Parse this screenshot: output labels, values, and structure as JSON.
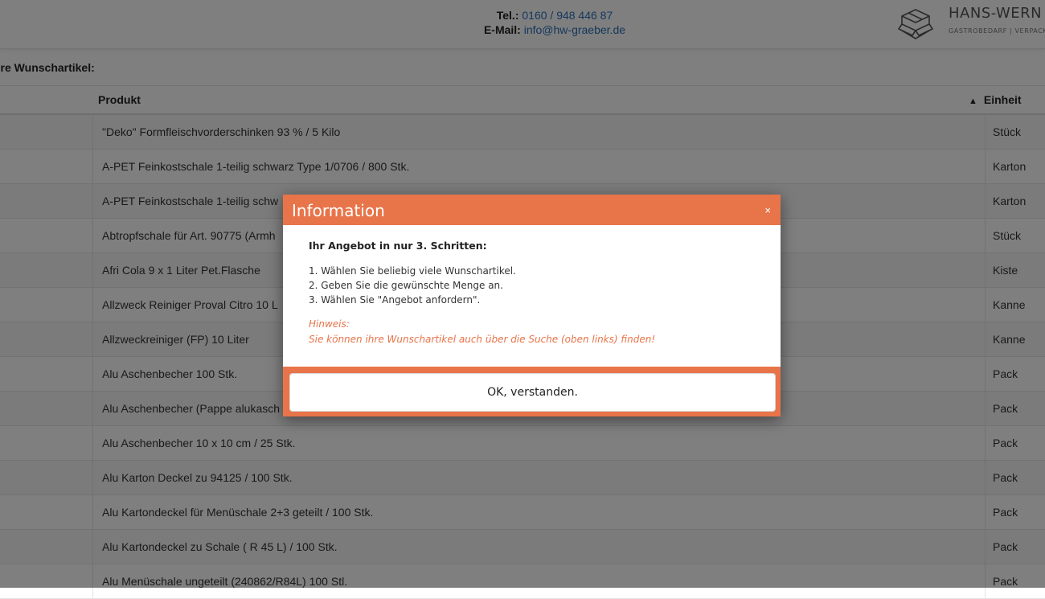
{
  "header": {
    "tel_label": "Tel.:",
    "tel_value": "0160 / 948 446 87",
    "email_label": "E-Mail:",
    "email_value": "info@hw-graeber.de",
    "logo_name": "HANS-WERN",
    "logo_tagline": "GASTROBEDARF | VERPACK",
    "logo_icon": "box-stack-icon"
  },
  "section_title": "hre Wunschartikel:",
  "table": {
    "col_product": "Produkt",
    "col_unit": "Einheit",
    "sort_icon": "caret-up-icon",
    "rows": [
      {
        "product": "\"Deko\" Formfleischvorderschinken 93 % / 5 Kilo",
        "unit": "Stück"
      },
      {
        "product": "A-PET Feinkostschale 1-teilig schwarz Type 1/0706 / 800 Stk.",
        "unit": "Karton"
      },
      {
        "product": "A-PET Feinkostschale 1-teilig schw",
        "unit": "Karton"
      },
      {
        "product": "Abtropfschale für Art. 90775 (Armh",
        "unit": "Stück"
      },
      {
        "product": "Afri Cola 9 x 1 Liter Pet.Flasche",
        "unit": "Kiste"
      },
      {
        "product": "Allzweck Reiniger Proval Citro 10 L",
        "unit": "Kanne"
      },
      {
        "product": "Allzweckreiniger (FP) 10 Liter",
        "unit": "Kanne"
      },
      {
        "product": "Alu Aschenbecher 100 Stk.",
        "unit": "Pack"
      },
      {
        "product": "Alu Aschenbecher (Pappe alukasch",
        "unit": "Pack"
      },
      {
        "product": "Alu Aschenbecher 10 x 10 cm / 25 Stk.",
        "unit": "Pack"
      },
      {
        "product": "Alu Karton Deckel zu 94125 / 100 Stk.",
        "unit": "Pack"
      },
      {
        "product": "Alu Kartondeckel für Menüschale 2+3 geteilt / 100 Stk.",
        "unit": "Pack"
      },
      {
        "product": "Alu Kartondeckel zu Schale ( R 45 L) / 100 Stk.",
        "unit": "Pack"
      },
      {
        "product": "Alu Menüschale ungeteilt (240862/R84L) 100 Stl.",
        "unit": "Pack"
      }
    ]
  },
  "modal": {
    "title": "Information",
    "close_symbol": "×",
    "heading": "Ihr Angebot in nur 3. Schritten:",
    "steps": [
      "1. Wählen Sie beliebig viele Wunschartikel.",
      "2. Geben Sie die gewünschte Menge an.",
      "3. Wählen Sie \"Angebot anfordern\"."
    ],
    "hint_label": "Hinweis:",
    "hint_text": "Sie können ihre Wunschartikel auch über die Suche (oben links) finden!",
    "ok_label": "OK, verstanden.",
    "accent_color": "#e8744a"
  }
}
